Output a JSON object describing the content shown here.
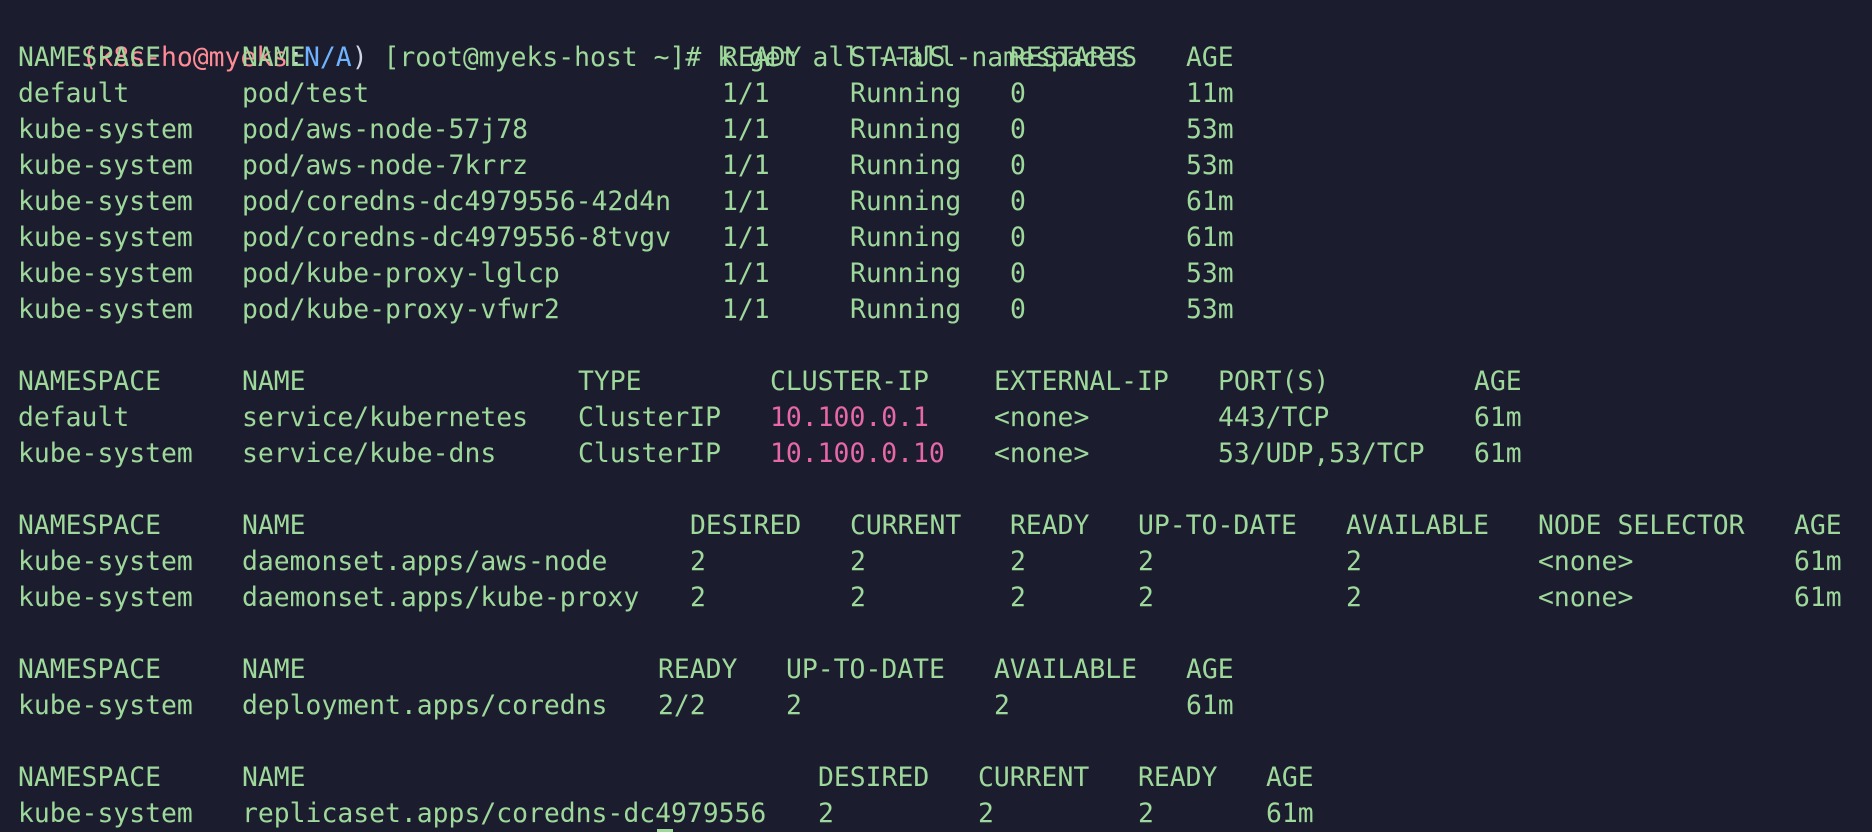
{
  "prompt": {
    "open_paren": "(",
    "context": "k8s-ho@myeks",
    "colon": ":",
    "namespace": "N/A",
    "close_paren": ")",
    "body": " [root@myeks-host ~]# k get all --all-namespaces"
  },
  "pods": {
    "headers": [
      "NAMESPACE",
      "NAME",
      "READY",
      "STATUS",
      "RESTARTS",
      "AGE"
    ],
    "rows": [
      [
        "default",
        "pod/test",
        "1/1",
        "Running",
        "0",
        "11m"
      ],
      [
        "kube-system",
        "pod/aws-node-57j78",
        "1/1",
        "Running",
        "0",
        "53m"
      ],
      [
        "kube-system",
        "pod/aws-node-7krrz",
        "1/1",
        "Running",
        "0",
        "53m"
      ],
      [
        "kube-system",
        "pod/coredns-dc4979556-42d4n",
        "1/1",
        "Running",
        "0",
        "61m"
      ],
      [
        "kube-system",
        "pod/coredns-dc4979556-8tvgv",
        "1/1",
        "Running",
        "0",
        "61m"
      ],
      [
        "kube-system",
        "pod/kube-proxy-lglcp",
        "1/1",
        "Running",
        "0",
        "53m"
      ],
      [
        "kube-system",
        "pod/kube-proxy-vfwr2",
        "1/1",
        "Running",
        "0",
        "53m"
      ]
    ]
  },
  "services": {
    "headers": [
      "NAMESPACE",
      "NAME",
      "TYPE",
      "CLUSTER-IP",
      "EXTERNAL-IP",
      "PORT(S)",
      "AGE"
    ],
    "rows": [
      [
        "default",
        "service/kubernetes",
        "ClusterIP",
        "10.100.0.1",
        "<none>",
        "443/TCP",
        "61m"
      ],
      [
        "kube-system",
        "service/kube-dns",
        "ClusterIP",
        "10.100.0.10",
        "<none>",
        "53/UDP,53/TCP",
        "61m"
      ]
    ]
  },
  "daemonsets": {
    "headers": [
      "NAMESPACE",
      "NAME",
      "DESIRED",
      "CURRENT",
      "READY",
      "UP-TO-DATE",
      "AVAILABLE",
      "NODE SELECTOR",
      "AGE"
    ],
    "rows": [
      [
        "kube-system",
        "daemonset.apps/aws-node",
        "2",
        "2",
        "2",
        "2",
        "2",
        "<none>",
        "61m"
      ],
      [
        "kube-system",
        "daemonset.apps/kube-proxy",
        "2",
        "2",
        "2",
        "2",
        "2",
        "<none>",
        "61m"
      ]
    ]
  },
  "deployments": {
    "headers": [
      "NAMESPACE",
      "NAME",
      "READY",
      "UP-TO-DATE",
      "AVAILABLE",
      "AGE"
    ],
    "rows": [
      [
        "kube-system",
        "deployment.apps/coredns",
        "2/2",
        "2",
        "2",
        "61m"
      ]
    ]
  },
  "replicasets": {
    "headers": [
      "NAMESPACE",
      "NAME",
      "DESIRED",
      "CURRENT",
      "READY",
      "AGE"
    ],
    "rows": [
      [
        "kube-system",
        "replicaset.apps/coredns-dc4979556",
        "2",
        "2",
        "2",
        "61m"
      ]
    ]
  },
  "colors": {
    "background": "#1b1d2e",
    "text": "#9ed89a",
    "context": "#ff8c96",
    "namespace": "#6fb3ff",
    "cluster_ip": "#e668a8"
  }
}
